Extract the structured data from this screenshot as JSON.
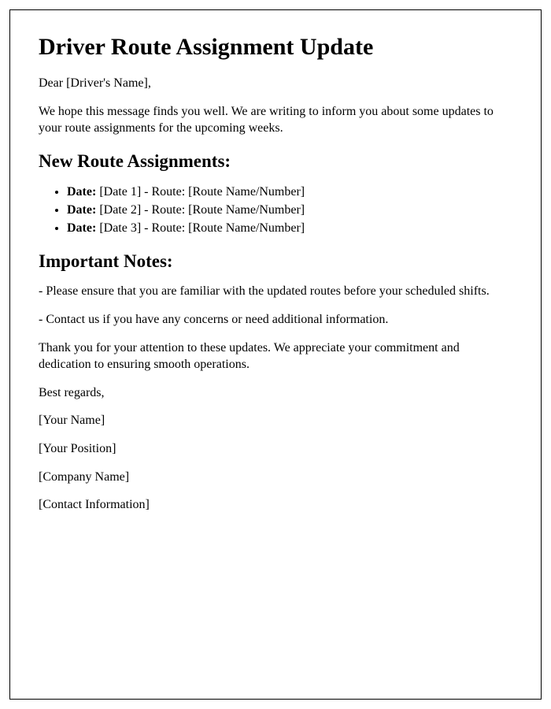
{
  "title": "Driver Route Assignment Update",
  "greeting": "Dear [Driver's Name],",
  "intro": "We hope this message finds you well. We are writing to inform you about some updates to your route assignments for the upcoming weeks.",
  "assignments_heading": "New Route Assignments:",
  "assignments": [
    {
      "label": "Date:",
      "text": " [Date 1] - Route: [Route Name/Number]"
    },
    {
      "label": "Date:",
      "text": " [Date 2] - Route: [Route Name/Number]"
    },
    {
      "label": "Date:",
      "text": " [Date 3] - Route: [Route Name/Number]"
    }
  ],
  "notes_heading": "Important Notes:",
  "note1": "- Please ensure that you are familiar with the updated routes before your scheduled shifts.",
  "note2": "- Contact us if you have any concerns or need additional information.",
  "thanks": "Thank you for your attention to these updates. We appreciate your commitment and dedication to ensuring smooth operations.",
  "signoff": "Best regards,",
  "sender_name": "[Your Name]",
  "sender_position": "[Your Position]",
  "company_name": "[Company Name]",
  "contact_info": "[Contact Information]"
}
